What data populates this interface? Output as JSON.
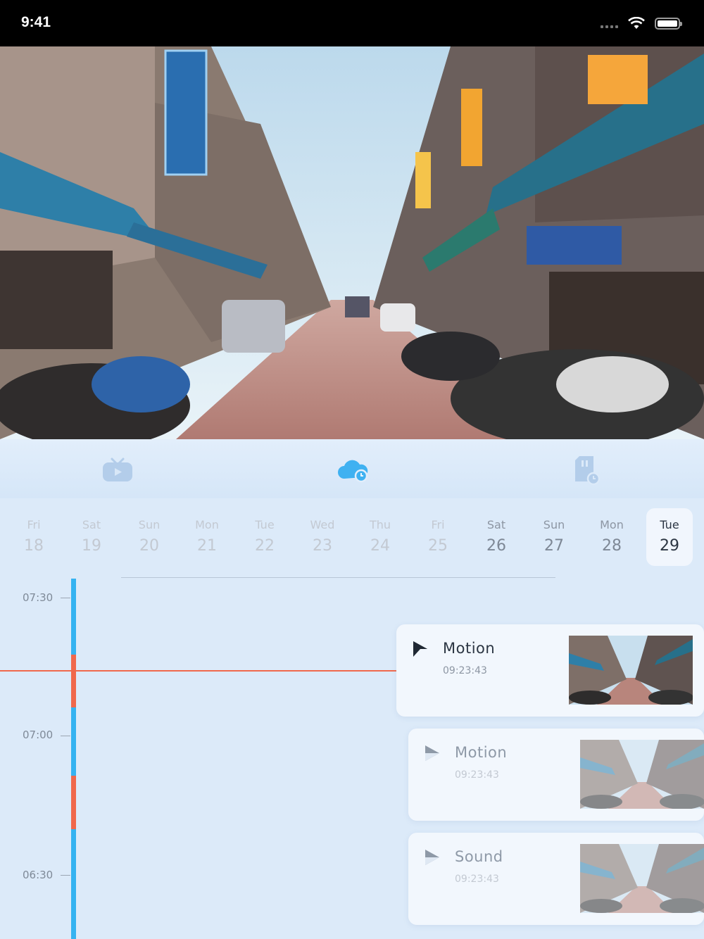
{
  "status": {
    "time": "9:41"
  },
  "tabs": [
    {
      "name": "live-tv-icon"
    },
    {
      "name": "cloud-recording-icon",
      "active": true
    },
    {
      "name": "sd-card-recording-icon"
    }
  ],
  "dates": [
    {
      "day": "Fri",
      "date": "18"
    },
    {
      "day": "Sat",
      "date": "19"
    },
    {
      "day": "Sun",
      "date": "20"
    },
    {
      "day": "Mon",
      "date": "21"
    },
    {
      "day": "Tue",
      "date": "22"
    },
    {
      "day": "Wed",
      "date": "23"
    },
    {
      "day": "Thu",
      "date": "24"
    },
    {
      "day": "Fri",
      "date": "25"
    },
    {
      "day": "Sat",
      "date": "26"
    },
    {
      "day": "Sun",
      "date": "27"
    },
    {
      "day": "Mon",
      "date": "28"
    },
    {
      "day": "Tue",
      "date": "29"
    }
  ],
  "timeline": {
    "labels": [
      "07:30",
      "07:00",
      "06:30"
    ]
  },
  "events": [
    {
      "title": "Motion",
      "time": "09:23:43"
    },
    {
      "title": "Motion",
      "time": "09:23:43"
    },
    {
      "title": "Sound",
      "time": "09:23:43"
    }
  ],
  "colors": {
    "accent_blue": "#35b3f1",
    "event_red": "#f0684c",
    "background": "#dceaf9"
  }
}
